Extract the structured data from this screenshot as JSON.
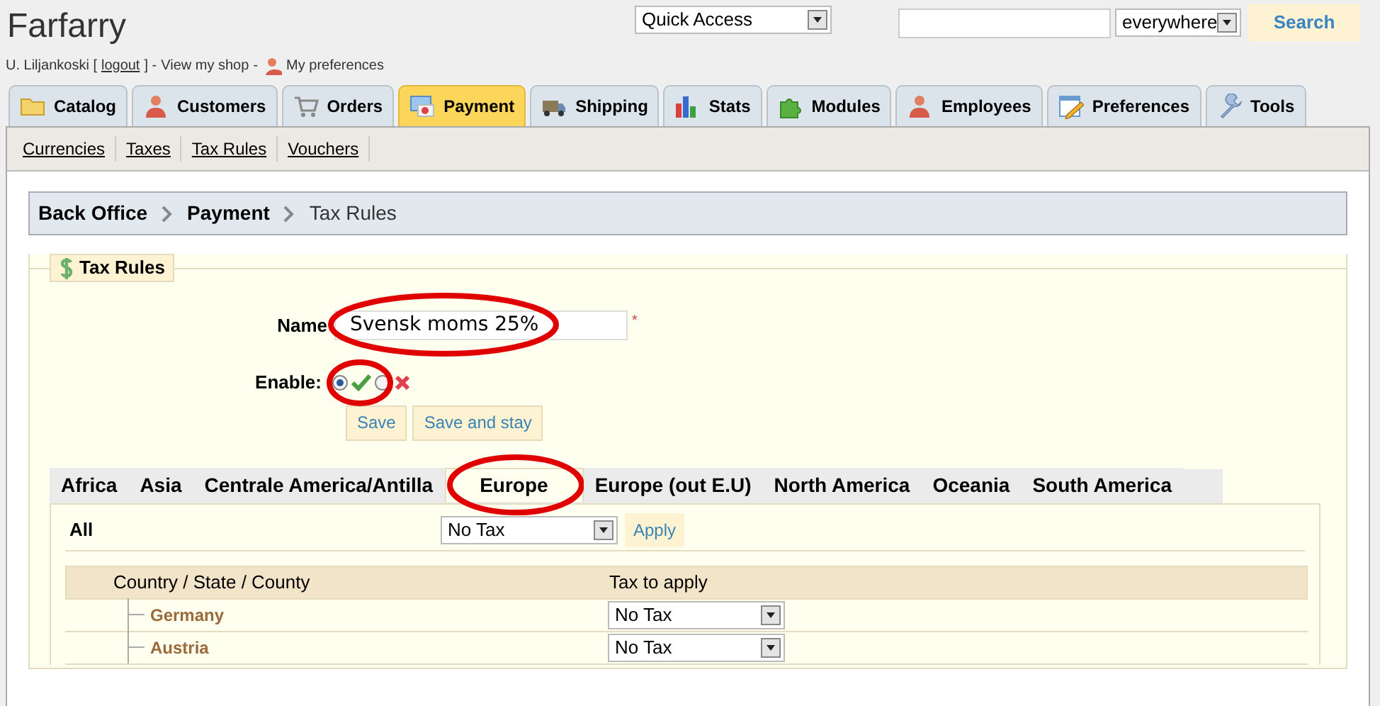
{
  "shop_name": "Farfarry",
  "quick_access": {
    "value": "Quick Access"
  },
  "search": {
    "scope": "everywhere",
    "button": "Search"
  },
  "user_bar": {
    "user": "U. Liljankoski [",
    "logout": "logout",
    "sep1": "] -",
    "view_shop": "View my shop",
    "sep2": "-",
    "preferences": "My preferences"
  },
  "tabs": [
    {
      "label": "Catalog",
      "selected": false
    },
    {
      "label": "Customers",
      "selected": false
    },
    {
      "label": "Orders",
      "selected": false
    },
    {
      "label": "Payment",
      "selected": true
    },
    {
      "label": "Shipping",
      "selected": false
    },
    {
      "label": "Stats",
      "selected": false
    },
    {
      "label": "Modules",
      "selected": false
    },
    {
      "label": "Employees",
      "selected": false
    },
    {
      "label": "Preferences",
      "selected": false
    },
    {
      "label": "Tools",
      "selected": false
    }
  ],
  "subtabs": [
    "Currencies",
    "Taxes",
    "Tax Rules",
    "Vouchers"
  ],
  "breadcrumb": [
    "Back Office",
    "Payment",
    "Tax Rules"
  ],
  "form": {
    "legend": "Tax Rules",
    "name_label": "Name",
    "name_value": "Svensk moms 25%",
    "name_circled": true,
    "required_mark": "*",
    "enable_label": "Enable:",
    "enabled": true,
    "enable_circled": true,
    "buttons": [
      "Save",
      "Save and stay"
    ]
  },
  "region_tabs": [
    {
      "label": "Africa",
      "selected": false,
      "circled": false
    },
    {
      "label": "Asia",
      "selected": false,
      "circled": false
    },
    {
      "label": "Centrale America/Antilla",
      "selected": false,
      "circled": false
    },
    {
      "label": "Europe",
      "selected": true,
      "circled": true
    },
    {
      "label": "Europe (out E.U)",
      "selected": false,
      "circled": false
    },
    {
      "label": "North America",
      "selected": false,
      "circled": false
    },
    {
      "label": "Oceania",
      "selected": false,
      "circled": false
    },
    {
      "label": "South America",
      "selected": false,
      "circled": false
    }
  ],
  "all_row": {
    "label": "All",
    "tax": "No Tax",
    "button": "Apply"
  },
  "table": {
    "columns": [
      "Country / State / County",
      "Tax to apply"
    ],
    "rows": [
      {
        "country": "Germany",
        "tax": "No Tax"
      },
      {
        "country": "Austria",
        "tax": "No Tax"
      }
    ]
  }
}
